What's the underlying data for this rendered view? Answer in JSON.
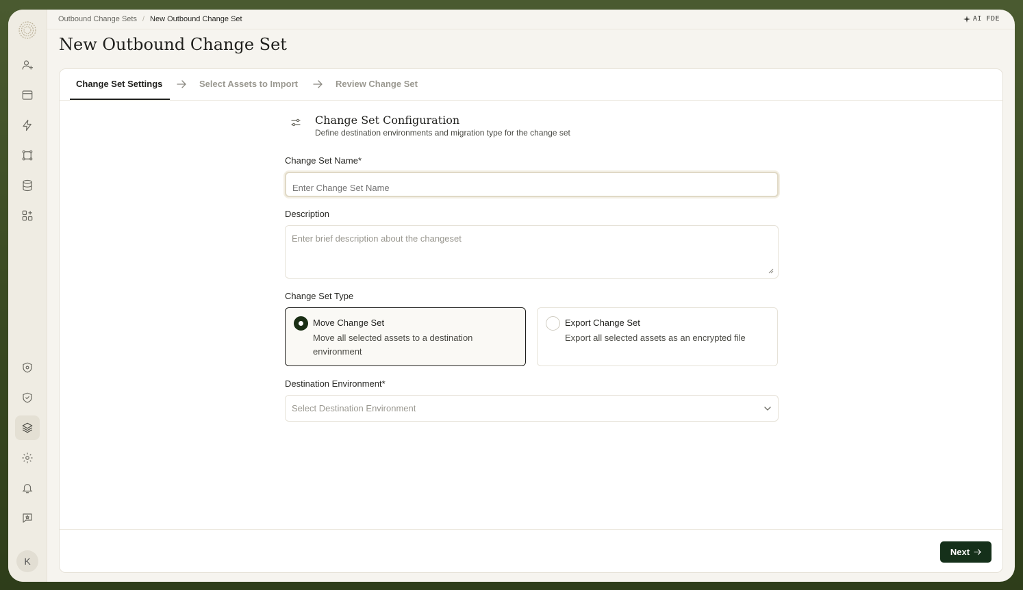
{
  "breadcrumb": {
    "parent": "Outbound Change Sets",
    "separator": "/",
    "current": "New Outbound Change Set"
  },
  "topbar": {
    "ai_label": "AI FDE"
  },
  "page": {
    "title": "New Outbound Change Set"
  },
  "steps": [
    {
      "label": "Change Set Settings",
      "active": true
    },
    {
      "label": "Select Assets to Import",
      "active": false
    },
    {
      "label": "Review Change Set",
      "active": false
    }
  ],
  "section": {
    "title": "Change Set Configuration",
    "subtitle": "Define destination environments and migration type for the change set"
  },
  "form": {
    "name_label": "Change Set Name*",
    "name_placeholder": "Enter Change Set Name",
    "desc_label": "Description",
    "desc_placeholder": "Enter brief description about the changeset",
    "type_label": "Change Set Type",
    "type_options": [
      {
        "title": "Move Change Set",
        "desc": "Move all selected assets to a destination environment",
        "selected": true
      },
      {
        "title": "Export Change Set",
        "desc": "Export all selected assets as an encrypted file",
        "selected": false
      }
    ],
    "dest_label": "Destination Environment*",
    "dest_placeholder": "Select Destination Environment"
  },
  "footer": {
    "next_label": "Next"
  },
  "user": {
    "avatar_initial": "K"
  },
  "colors": {
    "primary": "#15301a",
    "background": "#f6f4ef",
    "sidebar": "#efece3"
  },
  "sidebar_icons": [
    "user-plus-icon",
    "card-icon",
    "bolt-icon",
    "nodes-icon",
    "database-icon",
    "apps-icon",
    "shield-circle-icon",
    "shield-check-icon",
    "layers-icon",
    "gear-icon",
    "bell-icon",
    "feedback-icon"
  ]
}
